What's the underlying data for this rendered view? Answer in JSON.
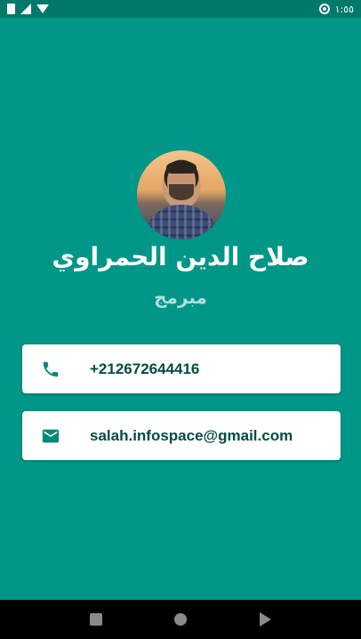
{
  "status_bar": {
    "time": "١:٥٥",
    "icons": [
      "sim-icon",
      "signal-icon",
      "wifi-icon",
      "data-saver-icon"
    ]
  },
  "profile": {
    "name": "صلاح الدين الحمراوي",
    "title": "مبرمج"
  },
  "contacts": {
    "phone": "+212672644416",
    "email": "salah.infospace@gmail.com"
  },
  "colors": {
    "background": "#009688",
    "status_bar": "#00796B",
    "title_text": "#B2DFDB",
    "contact_text": "#004D40",
    "icon": "#00897B"
  },
  "nav_bar": {
    "buttons": [
      "recents-icon",
      "home-icon",
      "back-icon"
    ]
  }
}
